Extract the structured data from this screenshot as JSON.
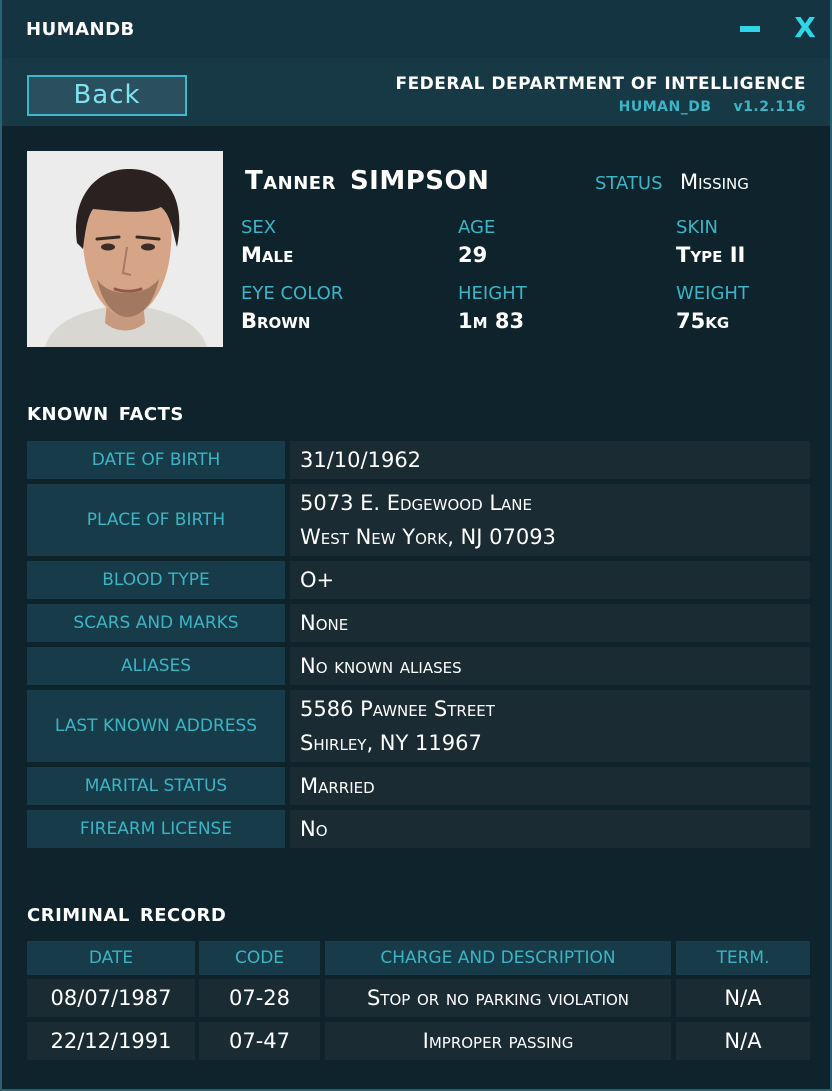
{
  "window": {
    "title": "HUMANDB",
    "minimize_icon": "minimize-icon",
    "close_label": "X"
  },
  "header": {
    "back_label": "Back",
    "department": "FEDERAL DEPARTMENT OF INTELLIGENCE",
    "app_code": "HUMAN_DB",
    "version": "v1.2.116"
  },
  "profile": {
    "first_name": "Tanner",
    "last_name": "SIMPSON",
    "status_label": "STATUS",
    "status_value": "Missing",
    "attributes": [
      {
        "label": "SEX",
        "value": "Male"
      },
      {
        "label": "AGE",
        "value": "29"
      },
      {
        "label": "SKIN",
        "value": "Type II"
      },
      {
        "label": "EYE COLOR",
        "value": "Brown"
      },
      {
        "label": "HEIGHT",
        "value": "1m 83"
      },
      {
        "label": "WEIGHT",
        "value": "75kg"
      }
    ]
  },
  "known_facts": {
    "title_1": "KNOWN",
    "title_2": "FACTS",
    "rows": [
      {
        "label": "DATE OF BIRTH",
        "lines": [
          "31/10/1962"
        ]
      },
      {
        "label": "PLACE OF BIRTH",
        "lines": [
          "5073 E. Edgewood Lane",
          "West New York, NJ 07093"
        ]
      },
      {
        "label": "BLOOD TYPE",
        "lines": [
          "O+"
        ]
      },
      {
        "label": "SCARS AND MARKS",
        "lines": [
          "None"
        ]
      },
      {
        "label": "ALIASES",
        "lines": [
          "No known aliases"
        ]
      },
      {
        "label": "LAST KNOWN ADDRESS",
        "lines": [
          "5586 Pawnee Street",
          "Shirley, NY 11967"
        ]
      },
      {
        "label": "MARITAL STATUS",
        "lines": [
          "Married"
        ]
      },
      {
        "label": "FIREARM LICENSE",
        "lines": [
          "No"
        ]
      }
    ]
  },
  "criminal_record": {
    "title_1": "CRIMINAL",
    "title_2": "RECORD",
    "columns": [
      "DATE",
      "CODE",
      "CHARGE AND DESCRIPTION",
      "TERM."
    ],
    "rows": [
      [
        "08/07/1987",
        "07-28",
        "Stop or no parking violation",
        "N/A"
      ],
      [
        "22/12/1991",
        "07-47",
        "Improper passing",
        "N/A"
      ]
    ]
  },
  "colors": {
    "accent": "#3bb5c5",
    "icon_accent": "#2fd5e8",
    "background": "#0f232d",
    "text": "#ffffff"
  }
}
